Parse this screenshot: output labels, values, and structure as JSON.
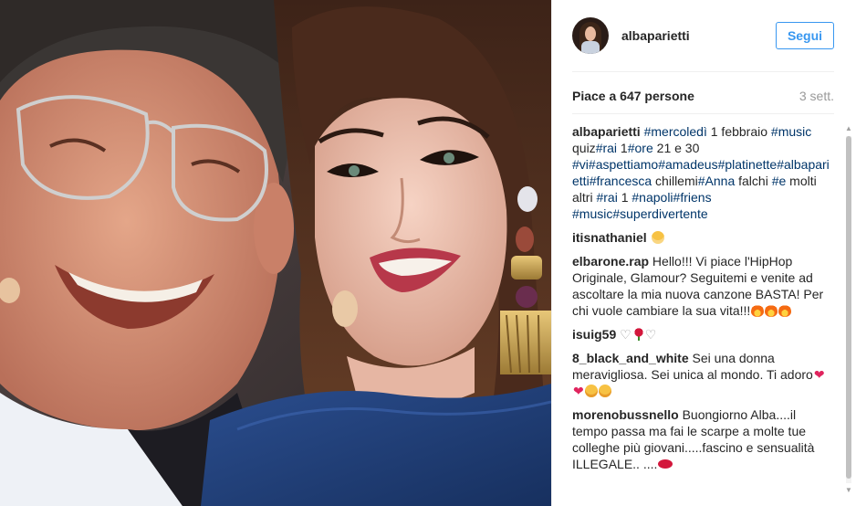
{
  "post": {
    "username": "albaparietti",
    "follow_label": "Segui",
    "likes": "Piace a 647 persone",
    "time": "3 sett."
  },
  "caption": {
    "author": "albaparietti",
    "parts": [
      {
        "tag": "#mercoledì"
      },
      {
        "text": " 1 febbraio "
      },
      {
        "tag": "#music"
      },
      {
        "text": " quiz"
      },
      {
        "tag": "#rai"
      },
      {
        "text": " 1"
      },
      {
        "tag": "#ore"
      },
      {
        "text": " 21 e 30 "
      },
      {
        "tag": "#vi"
      },
      {
        "tag": "#aspettiamo"
      },
      {
        "tag": "#amadeus"
      },
      {
        "tag": "#platinette"
      },
      {
        "tag": "#albaparietti"
      },
      {
        "tag": "#francesca"
      },
      {
        "text": " chillemi"
      },
      {
        "tag": "#Anna"
      },
      {
        "text": " falchi "
      },
      {
        "tag": "#e"
      },
      {
        "text": " molti altri "
      },
      {
        "tag": "#rai"
      },
      {
        "text": " 1 "
      },
      {
        "tag": "#napoli"
      },
      {
        "tag": "#friens"
      },
      {
        "text": " "
      },
      {
        "tag": "#music"
      },
      {
        "tag": "#superdivertente"
      }
    ]
  },
  "comments": [
    {
      "author": "itisnathaniel",
      "text": "",
      "emoji": [
        "grin"
      ]
    },
    {
      "author": "elbarone.rap",
      "text": "Hello!!! Vi piace l'HipHop Originale, Glamour? Seguitemi e venite ad ascoltare la mia nuova canzone BASTA! Per chi vuole cambiare la sua vita!!!",
      "emoji": [
        "fire",
        "fire",
        "fire"
      ]
    },
    {
      "author": "isuig59",
      "text": "♡",
      "emoji": [
        "rose"
      ],
      "suffix": "♡"
    },
    {
      "author": "8_black_and_white",
      "text": "Sei una donna meravigliosa. Sei unica al mondo. Ti adoro",
      "emoji": [
        "heart",
        "heart",
        "smile",
        "smile"
      ]
    },
    {
      "author": "morenobussnello",
      "text": "Buongiorno Alba....il tempo passa ma fai le scarpe a molte tue colleghe più giovani.....fascino e sensualità ILLEGALE.. ....",
      "emoji": [
        "lips"
      ]
    }
  ],
  "colors": {
    "link": "#003569",
    "accent": "#3897f0",
    "muted": "#999999"
  },
  "icons": {
    "scroll_up": "▲",
    "scroll_down": "▼"
  }
}
